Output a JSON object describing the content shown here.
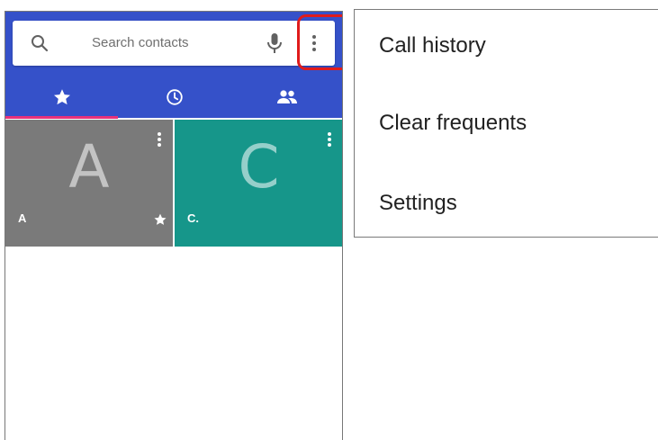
{
  "search": {
    "placeholder": "Search contacts"
  },
  "tabs": [
    {
      "name": "favorites",
      "icon": "star-icon",
      "selected": true
    },
    {
      "name": "recents",
      "icon": "clock-icon",
      "selected": false
    },
    {
      "name": "contacts",
      "icon": "people-icon",
      "selected": false
    }
  ],
  "favorites": [
    {
      "letter": "A",
      "name": "A",
      "starred": true,
      "color": "#7a7a7a"
    },
    {
      "letter": "C",
      "name": "C.",
      "starred": false,
      "color": "#16968a"
    }
  ],
  "menu": {
    "items": [
      {
        "label": "Call history"
      },
      {
        "label": "Clear frequents"
      },
      {
        "label": "Settings"
      }
    ]
  },
  "colors": {
    "appbar": "#3551c9",
    "tab_indicator": "#e8317a",
    "highlight": "#e01b1b"
  }
}
